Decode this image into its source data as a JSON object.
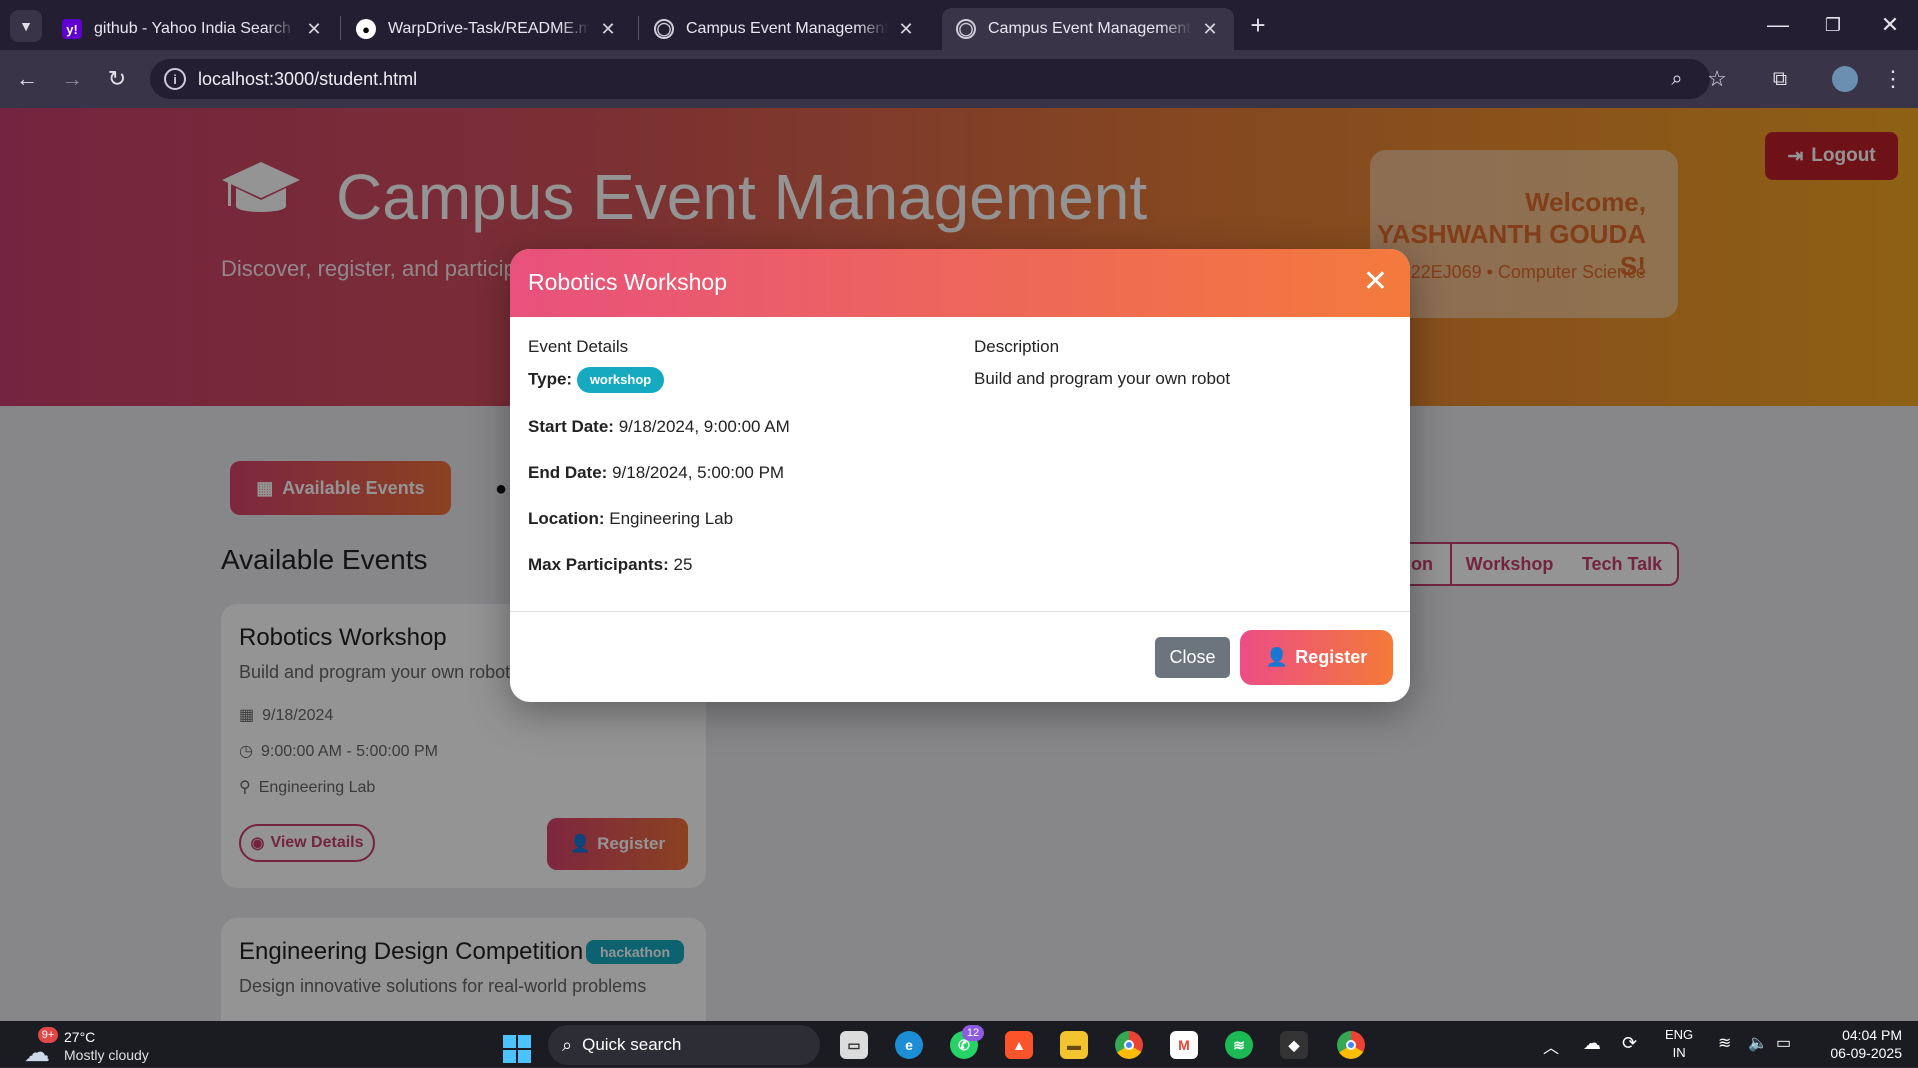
{
  "browser": {
    "tabs": [
      {
        "title": "github - Yahoo India Search Res",
        "favicon": "yahoo-icon"
      },
      {
        "title": "WarpDrive-Task/README.md at",
        "favicon": "github-icon"
      },
      {
        "title": "Campus Event Management Pla",
        "favicon": "globe-icon"
      },
      {
        "title": "Campus Event Management - S",
        "favicon": "globe-icon",
        "active": true
      }
    ],
    "url": "localhost:3000/student.html"
  },
  "header": {
    "title": "Campus Event Management",
    "subtitle": "Discover, register, and participate in campus events",
    "welcome": "Welcome, YASHWANTH GOUDA S!",
    "welcome_meta": "22EJ069 • Computer Science",
    "logout_label": "Logout"
  },
  "nav": {
    "available_label": "Available Events"
  },
  "events_section": {
    "heading": "Available Events",
    "filters": [
      "on",
      "Workshop",
      "Tech Talk"
    ]
  },
  "events": [
    {
      "title": "Robotics Workshop",
      "badge": "workshop",
      "description": "Build and program your own robot",
      "date": "9/18/2024",
      "time": "9:00:00 AM - 5:00:00 PM",
      "location": "Engineering Lab",
      "view_label": "View Details",
      "register_label": "Register"
    },
    {
      "title": "Engineering Design Competition",
      "badge": "hackathon",
      "description": "Design innovative solutions for real-world problems"
    }
  ],
  "modal": {
    "title": "Robotics Workshop",
    "details_heading": "Event Details",
    "type_label": "Type:",
    "type_value": "workshop",
    "start_label": "Start Date:",
    "start_value": "9/18/2024, 9:00:00 AM",
    "end_label": "End Date:",
    "end_value": "9/18/2024, 5:00:00 PM",
    "location_label": "Location:",
    "location_value": "Engineering Lab",
    "max_label": "Max Participants:",
    "max_value": "25",
    "description_heading": "Description",
    "description_value": "Build and program your own robot",
    "close_label": "Close",
    "register_label": "Register"
  },
  "taskbar": {
    "weather_temp": "27°C",
    "weather_desc": "Mostly cloudy",
    "weather_badge": "9+",
    "search_label": "Quick search",
    "whatsapp_badge": "12",
    "lang_top": "ENG",
    "lang_bottom": "IN",
    "time": "04:04 PM",
    "date": "06-09-2025"
  },
  "colors": {
    "accent_pink": "#c93f6e",
    "accent_orange": "#f0713a",
    "badge_cyan": "#15aabf"
  }
}
